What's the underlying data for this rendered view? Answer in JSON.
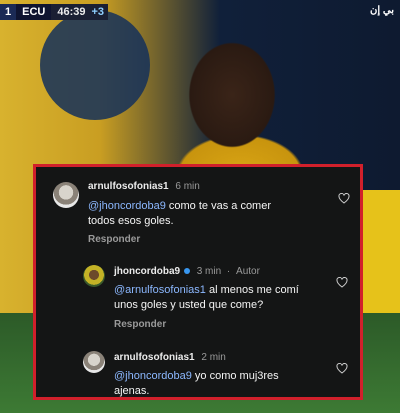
{
  "scoreboard": {
    "score": "1",
    "team": "ECU",
    "time": "46:39",
    "added": "+3",
    "channel": "بي إن"
  },
  "comments": [
    {
      "username": "arnulfosofonias1",
      "time": "6 min",
      "mention": "@jhoncordoba9",
      "line1": "como te vas a comer",
      "line2": "todos esos goles.",
      "reply": "Responder"
    },
    {
      "username": "jhoncordoba9",
      "time": "3 min",
      "author": "Autor",
      "separator": "·",
      "mention": "@arnulfosofonias1",
      "line1": "al menos me comí",
      "line2": "unos goles y usted que  come?",
      "reply": "Responder"
    },
    {
      "username": "arnulfosofonias1",
      "time": "2 min",
      "mention": "@jhoncordoba9",
      "line1": "yo como muj3res",
      "line2": "ajenas."
    }
  ],
  "colors": {
    "panel_bg": "#141515",
    "panel_border": "#d1202b",
    "mention": "#8cb8ff",
    "verified_badge": "#3897f0"
  },
  "icons": [
    "heart-icon",
    "verified-badge-icon"
  ]
}
